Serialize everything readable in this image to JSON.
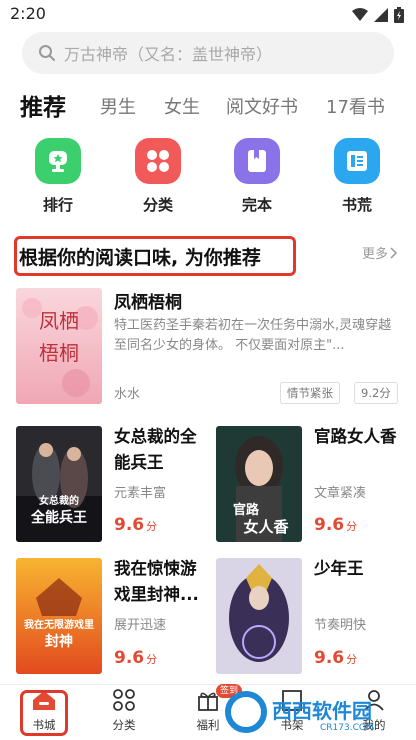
{
  "status": {
    "time": "2:20"
  },
  "search": {
    "placeholder": "万古神帝（又名：盖世神帝）"
  },
  "tabs": [
    {
      "label": "推荐"
    },
    {
      "label": "男生"
    },
    {
      "label": "女生"
    },
    {
      "label": "阅文好书"
    },
    {
      "label": "17看书"
    }
  ],
  "categories": [
    {
      "label": "排行",
      "icon": "trophy-icon",
      "color": "#3ccf6e"
    },
    {
      "label": "分类",
      "icon": "grid-icon",
      "color": "#f25a5a"
    },
    {
      "label": "完本",
      "icon": "book-icon",
      "color": "#8a72e8"
    },
    {
      "label": "书荒",
      "icon": "bookshelf-icon",
      "color": "#2ba7f0"
    }
  ],
  "section": {
    "title": "根据你的阅读口味, 为你推荐",
    "more": "更多"
  },
  "featured": {
    "title": "凤栖梧桐",
    "cover_text": "凤栖梧桐",
    "description": "特工医药圣手秦若初在一次任务中溺水,灵魂穿越至同名少女的身体。 不仅要面对原主\"...",
    "author": "水水",
    "tags": [
      "情节紧张",
      "9.2分"
    ]
  },
  "books": [
    {
      "title": "女总裁的全能兵王",
      "tag": "元素丰富",
      "score": "9.6",
      "unit": "分",
      "cover_text": "女总裁的全能兵王"
    },
    {
      "title": "官路女人香",
      "tag": "文章紧凑",
      "score": "9.6",
      "unit": "分",
      "cover_text": "官路女人香"
    },
    {
      "title": "我在惊悚游戏里封神...",
      "tag": "展开迅速",
      "score": "9.6",
      "unit": "分",
      "cover_text": "我在无限游戏里封神"
    },
    {
      "title": "少年王",
      "tag": "节奏明快",
      "score": "9.6",
      "unit": "分",
      "cover_text": "少年王"
    }
  ],
  "nav": [
    {
      "label": "书城"
    },
    {
      "label": "分类"
    },
    {
      "label": "福利"
    },
    {
      "label": "书架"
    },
    {
      "label": "我的"
    }
  ],
  "badge": "签到",
  "watermark": {
    "brand": "西西软件园",
    "url": "CR173.COM"
  },
  "colors": {
    "accent": "#e24a33",
    "highlight_border": "#e0392b"
  }
}
